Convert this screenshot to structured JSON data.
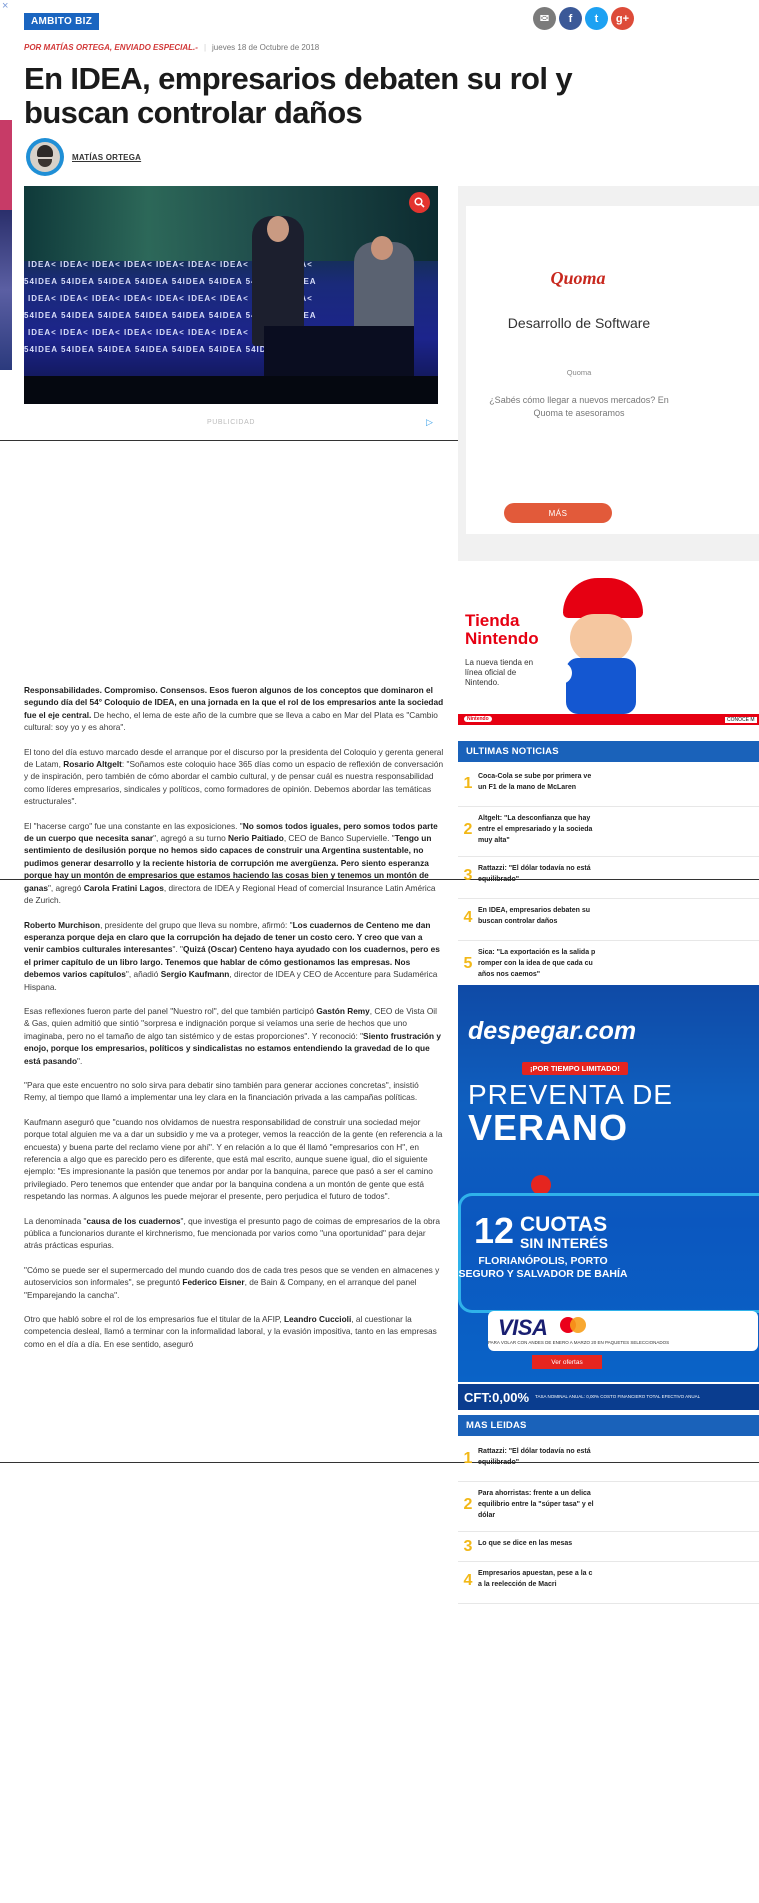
{
  "section_tag": "AMBITO BIZ",
  "share": {
    "mail": "✉",
    "facebook": "f",
    "twitter": "t",
    "gplus": "g+"
  },
  "byline": {
    "author": "POR MATÍAS ORTEGA, ENVIADO ESPECIAL.-",
    "date": "jueves 18 de Octubre de 2018"
  },
  "title": "En IDEA, empresarios debaten su rol y buscan controlar daños",
  "author_name": "MATÍAS ORTEGA",
  "hero": {
    "logo_rows": [
      "IDEA< IDEA< IDEA< IDEA< IDEA< IDEA< IDEA< IDEA< IDEA<",
      "54IDEA 54IDEA 54IDEA 54IDEA 54IDEA 54IDEA 54IDEA 54IDEA",
      "IDEA< IDEA< IDEA< IDEA< IDEA< IDEA< IDEA< IDEA< IDEA<",
      "54IDEA 54IDEA 54IDEA 54IDEA 54IDEA 54IDEA 54IDEA 54IDEA",
      "IDEA< IDEA< IDEA< IDEA< IDEA< IDEA< IDEA< IDEA< IDEA<",
      "54IDEA 54IDEA 54IDEA 54IDEA 54IDEA 54IDEA 54IDEA 54IDEA"
    ]
  },
  "ad_label": "PUBLICIDAD",
  "ad_arrow": "▷",
  "edge_close": "×",
  "body": [
    "<b>Responsabilidades. Compromiso. Consensos. Esos fueron algunos de los conceptos que dominaron el segundo día del 54° Coloquio de IDEA, en una jornada en la que el rol de los empresarios ante la sociedad fue el eje central.</b> De hecho, el lema de este año de la cumbre que se lleva a cabo en Mar del Plata es \"Cambio cultural: soy yo y es ahora\".",
    "El tono del día estuvo marcado desde el arranque por el discurso por la presidenta del Coloquio y gerenta general de Latam, <b>Rosario Altgelt</b>: \"Soñamos este coloquio hace 365 días como un espacio de reflexión de conversación y de inspiración, pero también de cómo abordar el cambio cultural, y de pensar cuál es nuestra responsabilidad como líderes empresarios, sindicales y políticos, como formadores de opinión. Debemos abordar las temáticas estructurales\".",
    "El \"hacerse cargo\" fue una constante en las exposiciones. \"<b>No somos todos iguales, pero somos todos parte de un cuerpo que necesita sanar</b>\", agregó a su turno <b>Nerio Paitiado</b>, CEO de Banco Supervielle. \"<b>Tengo un sentimiento de desilusión porque no hemos sido capaces de construir una Argentina sustentable, no pudimos generar desarrollo y la reciente historia de corrupción me avergüenza. Pero siento esperanza porque hay un montón de empresarios que estamos haciendo las cosas bien y tenemos un montón de ganas</b>\", agregó <b>Carola Fratini Lagos</b>, directora de IDEA y Regional Head of comercial Insurance Latin América de Zurich.",
    "<b>Roberto Murchison</b>, presidente del grupo que lleva su nombre, afirmó: \"<b>Los cuadernos de Centeno me dan esperanza porque deja en claro que la corrupción ha dejado de tener un costo cero. Y creo que van a venir cambios culturales interesantes</b>\". \"<b>Quizá (Oscar) Centeno haya ayudado con los cuadernos, pero es el primer capítulo de un libro largo. Tenemos que hablar de cómo gestionamos las empresas. Nos debemos varios capítulos</b>\", añadió <b>Sergio Kaufmann</b>, director de IDEA y CEO de Accenture para Sudamérica Hispana.",
    "Esas reflexiones fueron parte del panel \"Nuestro rol\", del que también participó <b>Gastón Remy</b>, CEO de Vista Oil & Gas, quien admitió que sintió \"sorpresa e indignación porque si veíamos una serie de hechos que uno imaginaba, pero no el tamaño de algo tan sistémico y de estas proporciones\". Y reconoció: \"<b>Siento frustración y enojo, porque los empresarios, políticos y sindicalistas no estamos entendiendo la gravedad de lo que está pasando</b>\".",
    "\"Para que este encuentro no solo sirva para debatir sino también para generar acciones concretas\", insistió Remy, al tiempo que llamó a implementar una ley clara en la financiación privada a las campañas políticas.",
    "Kaufmann aseguró que \"cuando nos olvidamos de nuestra responsabilidad de construir una sociedad mejor porque total alguien me va a dar un subsidio y me va a proteger, vemos la reacción de la gente (en referencia a la encuesta) y buena parte del reclamo viene por ahí\". Y en relación a lo que él llamó \"empresarios con H\", en referencia a algo que es parecido pero es diferente, que está mal escrito, aunque suene igual, dio el siguiente ejemplo: \"Es impresionante la pasión que tenemos por andar por la banquina, parece que pasó a ser el camino privilegiado. Pero tenemos que entender que andar por la banquina condena a un montón de gente que está respetando las normas. A algunos les puede mejorar el presente, pero perjudica el futuro de todos\".",
    "La denominada \"<b>causa de los cuadernos</b>\", que investiga el presunto pago de coimas de empresarios de la obra pública a funcionarios durante el kirchnerismo, fue mencionada por varios como \"una oportunidad\" para dejar atrás prácticas espurias.",
    "\"Cómo se puede ser el supermercado del mundo cuando dos de cada tres pesos que se venden en almacenes y autoservicios son informales\", se preguntó <b>Federico Eisner</b>, de Bain & Company, en el arranque del panel \"Emparejando la cancha\".",
    "Otro que habló sobre el rol de los empresarios fue el titular de la AFIP, <b>Leandro Cuccioli</b>, al cuestionar la competencia desleal, llamó a terminar con la informalidad laboral, y la evasión impositiva, tanto en las empresas como en el día a día. En ese sentido, aseguró"
  ],
  "quoma": {
    "logo": "Quoma",
    "headline": "Desarrollo de Software",
    "brand": "Quoma",
    "desc": "¿Sabés cómo llegar a nuevos mercados? En Quoma te asesoramos",
    "cta": "MÁS"
  },
  "nintendo": {
    "title": "Tienda Nintendo",
    "sub": "La nueva tienda en línea oficial de Nintendo.",
    "badge": "Nintendo",
    "more": "CONOCE M"
  },
  "ultimas": {
    "header": "ULTIMAS NOTICIAS",
    "items": [
      {
        "n": "1",
        "lines": [
          "Coca-Cola se sube por primera ve",
          "un F1 de la mano de McLaren"
        ]
      },
      {
        "n": "2",
        "lines": [
          "Altgelt: \"La desconfianza que hay",
          "entre el empresariado y la socieda",
          "muy alta\""
        ]
      },
      {
        "n": "3",
        "lines": [
          "Rattazzi: \"El dólar todavía no está",
          "equilibrado\""
        ]
      },
      {
        "n": "4",
        "lines": [
          "En IDEA, empresarios debaten su",
          "buscan controlar daños"
        ]
      },
      {
        "n": "5",
        "lines": [
          "Sica: \"La exportación es la salida p",
          "romper con la idea de que cada cu",
          "años nos caemos\""
        ]
      }
    ]
  },
  "despegar": {
    "brand": "despegar.com",
    "promo": "¡POR TIEMPO LIMITADO!",
    "line1": "PREVENTA DE",
    "line2": "VERANO",
    "twelve": "12",
    "cuotas": "CUOTAS",
    "sin": "SIN INTERÉS",
    "dest": "FLORIANÓPOLIS, PORTO SEGURO Y SALVADOR DE BAHÍA",
    "visa": "VISA",
    "fine": "PARA VOLAR CON ANDES DE ENERO A MARZO 20 EN PAQUETES SELECCIONADOS",
    "offers": "Ver ofertas",
    "cft": "CFT:0,00%",
    "cft_fine": "TASA NOMINAL ANUAL: 0,00% COSTO FINANCIERO TOTAL EFECTIVO ANUAL"
  },
  "leidas": {
    "header": "MAS LEIDAS",
    "items": [
      {
        "n": "1",
        "lines": [
          "Rattazzi: \"El dólar todavía no está",
          "equilibrado\""
        ]
      },
      {
        "n": "2",
        "lines": [
          "Para ahorristas: frente a un delica",
          "equilibrio entre la \"súper tasa\" y el",
          "dólar"
        ]
      },
      {
        "n": "3",
        "lines": [
          "Lo que se dice en las mesas"
        ]
      },
      {
        "n": "4",
        "lines": [
          "Empresarios apuestan, pese a la c",
          "a la reelección de Macri"
        ]
      }
    ]
  }
}
